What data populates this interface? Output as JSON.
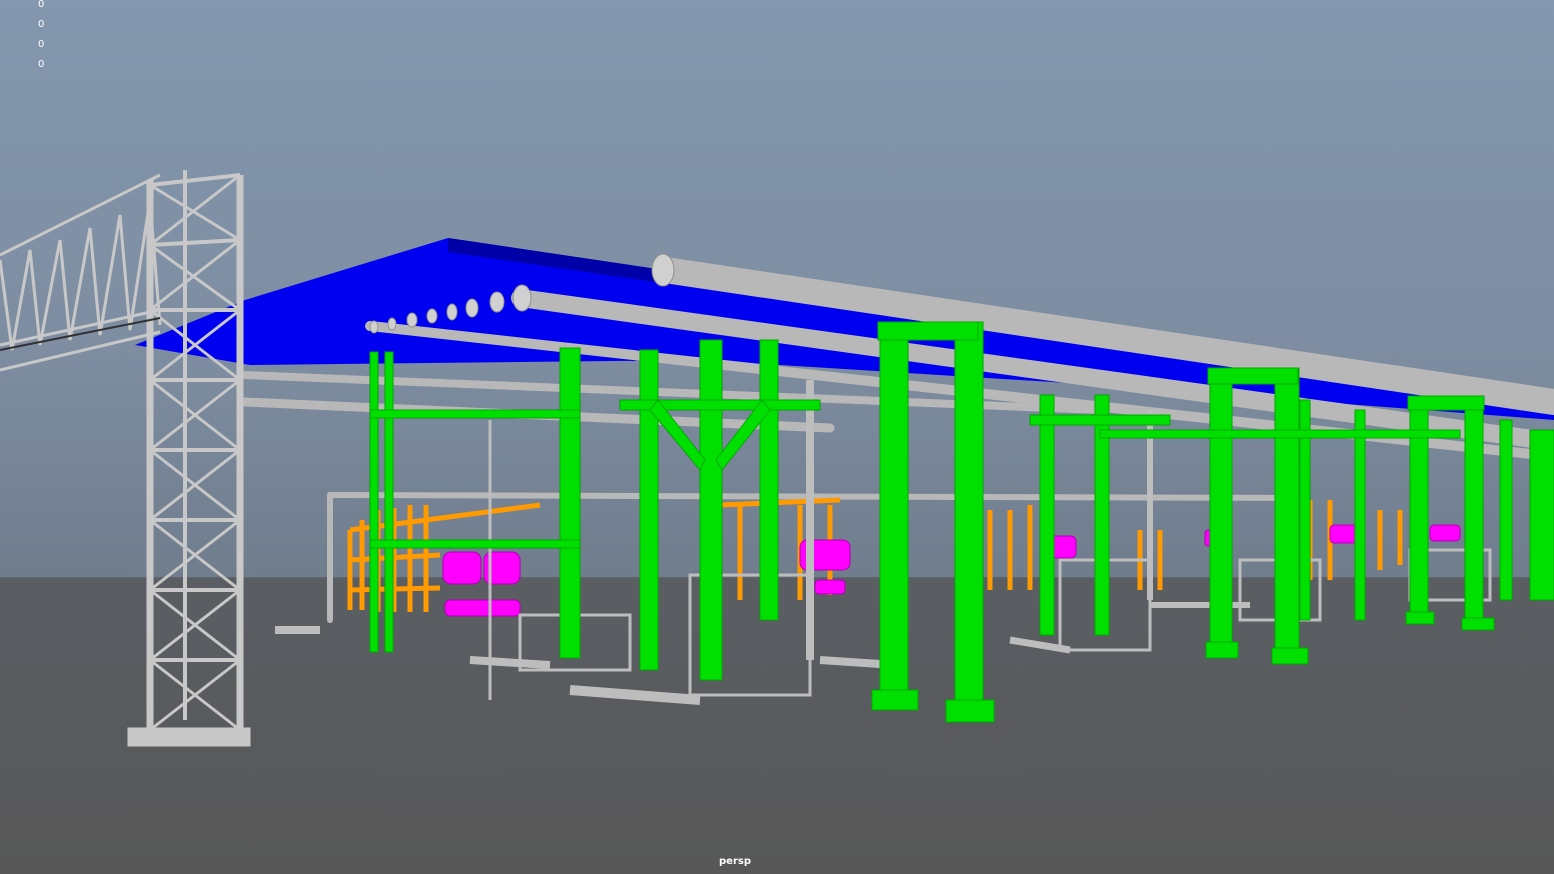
{
  "viewport": {
    "camera_name": "persp",
    "hud_counters": [
      "0",
      "0",
      "0",
      "0"
    ],
    "colors": {
      "sky_top": "#8397ae",
      "ground": "#575757",
      "pipe_rack_steel": "#00e000",
      "roof_deck": "#0000ff",
      "pipes": "#b4b4b4",
      "lattice_tower": "#c8c8c8",
      "orange_piping": "#ff9a00",
      "magenta_tanks": "#ff00ff"
    }
  }
}
